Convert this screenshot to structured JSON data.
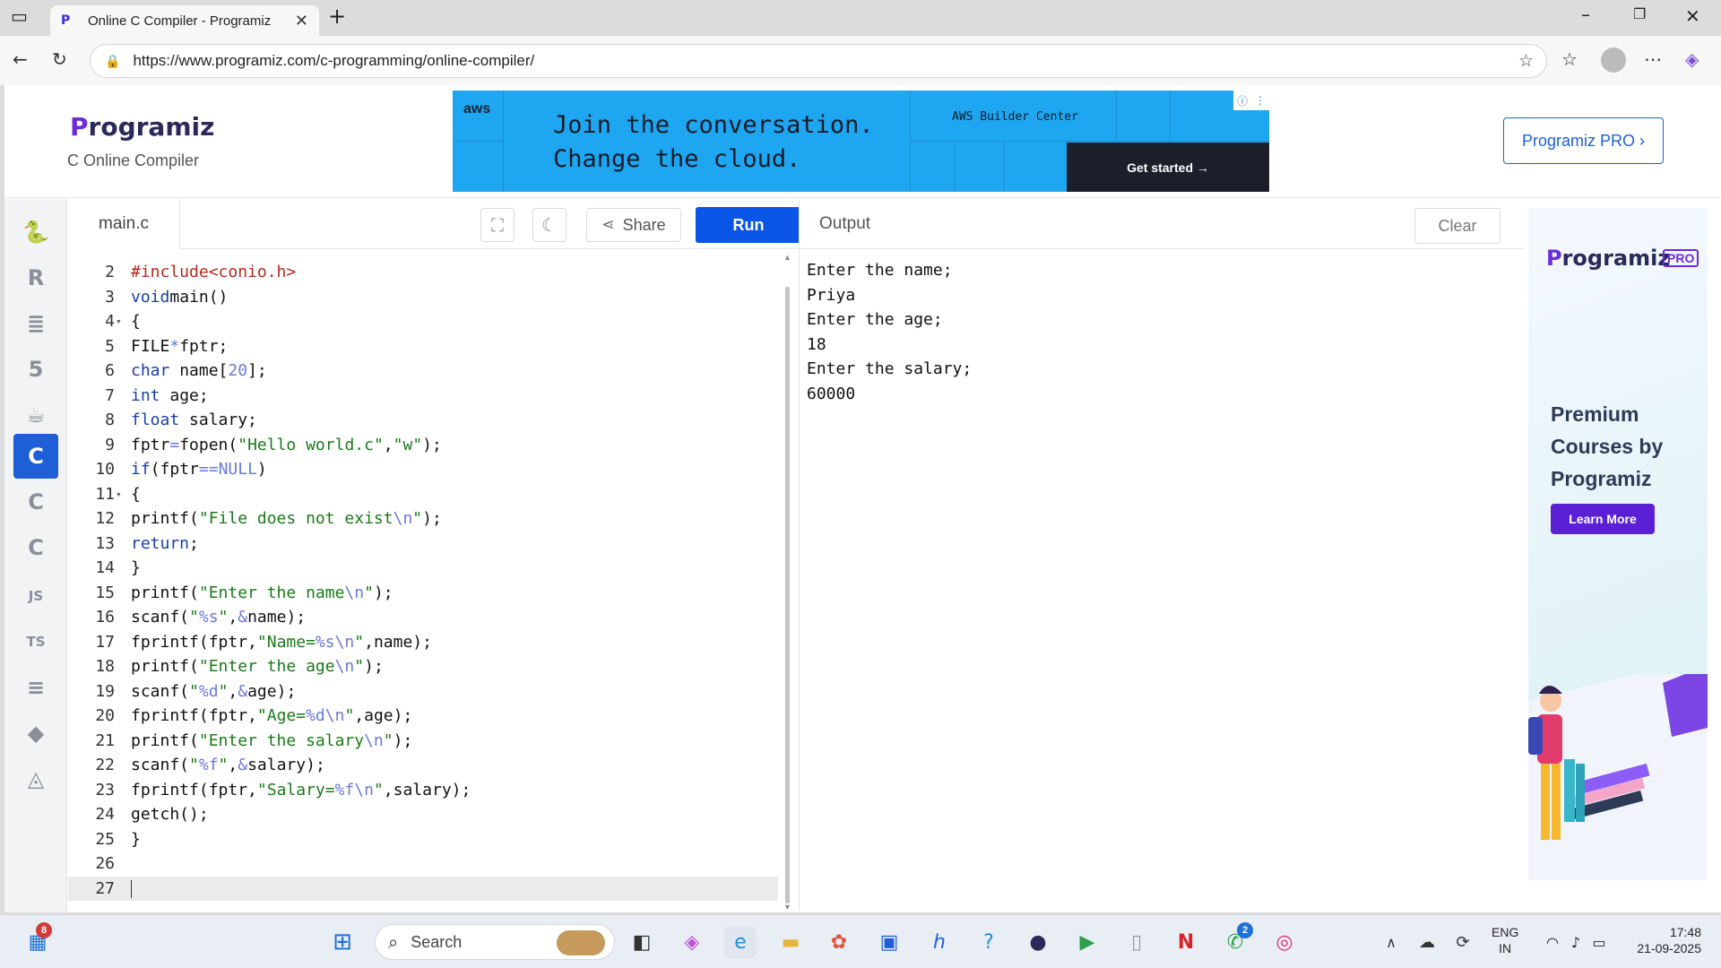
{
  "browser": {
    "tab_title": "Online C Compiler - Programiz",
    "url": "https://www.programiz.com/c-programming/online-compiler/"
  },
  "header": {
    "logo_text": "rogramiz",
    "logo_letter": "P",
    "subtitle": "C Online Compiler",
    "pro_button": "Programiz PRO ›"
  },
  "top_ad": {
    "brand": "aws",
    "headline_1": "Join the conversation.",
    "headline_2": "Change the cloud.",
    "builder": "AWS Builder Center",
    "cta": "Get started →"
  },
  "sidebar": {
    "items": [
      "python",
      "r",
      "sql",
      "html",
      "java",
      "c",
      "cpp",
      "csharp",
      "JS",
      "TS",
      "go",
      "swift",
      "rust"
    ],
    "active": "c"
  },
  "editor": {
    "file_name": "main.c",
    "share_label": "Share",
    "run_label": "Run",
    "lines": [
      {
        "n": "2",
        "fold": false
      },
      {
        "n": "3",
        "fold": false
      },
      {
        "n": "4",
        "fold": true
      },
      {
        "n": "5",
        "fold": false
      },
      {
        "n": "6",
        "fold": false
      },
      {
        "n": "7",
        "fold": false
      },
      {
        "n": "8",
        "fold": false
      },
      {
        "n": "9",
        "fold": false
      },
      {
        "n": "10",
        "fold": false
      },
      {
        "n": "11",
        "fold": true
      },
      {
        "n": "12",
        "fold": false
      },
      {
        "n": "13",
        "fold": false
      },
      {
        "n": "14",
        "fold": false
      },
      {
        "n": "15",
        "fold": false
      },
      {
        "n": "16",
        "fold": false
      },
      {
        "n": "17",
        "fold": false
      },
      {
        "n": "18",
        "fold": false
      },
      {
        "n": "19",
        "fold": false
      },
      {
        "n": "20",
        "fold": false
      },
      {
        "n": "21",
        "fold": false
      },
      {
        "n": "22",
        "fold": false
      },
      {
        "n": "23",
        "fold": false
      },
      {
        "n": "24",
        "fold": false
      },
      {
        "n": "25",
        "fold": false
      },
      {
        "n": "26",
        "fold": false
      },
      {
        "n": "27",
        "fold": false
      }
    ],
    "code": [
      [
        [
          "inc",
          "#include"
        ],
        [
          "inc",
          "<conio.h>"
        ]
      ],
      [
        [
          "kw",
          "void"
        ],
        [
          "",
          "main()"
        ]
      ],
      [
        [
          "",
          "{"
        ]
      ],
      [
        [
          "",
          "FILE"
        ],
        [
          "op",
          "*"
        ],
        [
          "",
          "fptr;"
        ]
      ],
      [
        [
          "kw",
          "char"
        ],
        [
          "",
          " name["
        ],
        [
          "esc",
          "20"
        ],
        [
          "",
          "];"
        ]
      ],
      [
        [
          "kw",
          "int"
        ],
        [
          "",
          " age;"
        ]
      ],
      [
        [
          "kw",
          "float"
        ],
        [
          "",
          " salary;"
        ]
      ],
      [
        [
          "",
          "fptr"
        ],
        [
          "op",
          "="
        ],
        [
          "",
          "fopen("
        ],
        [
          "str",
          "\"Hello world.c\""
        ],
        [
          "",
          ","
        ],
        [
          "str",
          "\"w\""
        ],
        [
          "",
          ");"
        ]
      ],
      [
        [
          "kw",
          "if"
        ],
        [
          "",
          "(fptr"
        ],
        [
          "op",
          "=="
        ],
        [
          "esc",
          "NULL"
        ],
        [
          "",
          ")"
        ]
      ],
      [
        [
          "",
          "{"
        ]
      ],
      [
        [
          "",
          "printf("
        ],
        [
          "str",
          "\"File does not exist"
        ],
        [
          "esc",
          "\\n"
        ],
        [
          "str",
          "\""
        ],
        [
          "",
          ");"
        ]
      ],
      [
        [
          "kw",
          "return"
        ],
        [
          "",
          ";"
        ]
      ],
      [
        [
          "",
          "}"
        ]
      ],
      [
        [
          "",
          "printf("
        ],
        [
          "str",
          "\"Enter the name"
        ],
        [
          "esc",
          "\\n"
        ],
        [
          "str",
          "\""
        ],
        [
          "",
          ");"
        ]
      ],
      [
        [
          "",
          "scanf("
        ],
        [
          "str",
          "\""
        ],
        [
          "esc",
          "%s"
        ],
        [
          "str",
          "\""
        ],
        [
          "",
          ","
        ],
        [
          "op",
          "&"
        ],
        [
          "",
          "name);"
        ]
      ],
      [
        [
          "",
          "fprintf(fptr,"
        ],
        [
          "str",
          "\"Name="
        ],
        [
          "esc",
          "%s\\n"
        ],
        [
          "str",
          "\""
        ],
        [
          "",
          ",name);"
        ]
      ],
      [
        [
          "",
          "printf("
        ],
        [
          "str",
          "\"Enter the age"
        ],
        [
          "esc",
          "\\n"
        ],
        [
          "str",
          "\""
        ],
        [
          "",
          ");"
        ]
      ],
      [
        [
          "",
          "scanf("
        ],
        [
          "str",
          "\""
        ],
        [
          "esc",
          "%d"
        ],
        [
          "str",
          "\""
        ],
        [
          "",
          ","
        ],
        [
          "op",
          "&"
        ],
        [
          "",
          "age);"
        ]
      ],
      [
        [
          "",
          "fprintf(fptr,"
        ],
        [
          "str",
          "\"Age="
        ],
        [
          "esc",
          "%d\\n"
        ],
        [
          "str",
          "\""
        ],
        [
          "",
          ",age);"
        ]
      ],
      [
        [
          "",
          "printf("
        ],
        [
          "str",
          "\"Enter the salary"
        ],
        [
          "esc",
          "\\n"
        ],
        [
          "str",
          "\""
        ],
        [
          "",
          ");"
        ]
      ],
      [
        [
          "",
          "scanf("
        ],
        [
          "str",
          "\""
        ],
        [
          "esc",
          "%f"
        ],
        [
          "str",
          "\""
        ],
        [
          "",
          ","
        ],
        [
          "op",
          "&"
        ],
        [
          "",
          "salary);"
        ]
      ],
      [
        [
          "",
          "fprintf(fptr,"
        ],
        [
          "str",
          "\"Salary="
        ],
        [
          "esc",
          "%f\\n"
        ],
        [
          "str",
          "\""
        ],
        [
          "",
          ",salary);"
        ]
      ],
      [
        [
          "",
          "getch();"
        ]
      ],
      [
        [
          "",
          "}"
        ]
      ],
      [],
      []
    ]
  },
  "output": {
    "title": "Output",
    "clear_label": "Clear",
    "lines": [
      "Enter the name;",
      "Priya",
      "Enter the age;",
      "18",
      "Enter the salary;",
      "60000"
    ]
  },
  "side_ad": {
    "logo_text": "rogramiz",
    "logo_letter": "P",
    "pro_tag": "PRO",
    "text": "Premium Courses by Programiz",
    "button": "Learn More"
  },
  "taskbar": {
    "search_placeholder": "Search",
    "widget_badge": "8",
    "whatsapp_badge": "2",
    "lang_1": "ENG",
    "lang_2": "IN",
    "time": "17:48",
    "date": "21-09-2025"
  },
  "colors": {
    "run_button": "#0a55e6",
    "active_lang": "#1e5fd8",
    "brand_purple": "#6c2bd9"
  }
}
